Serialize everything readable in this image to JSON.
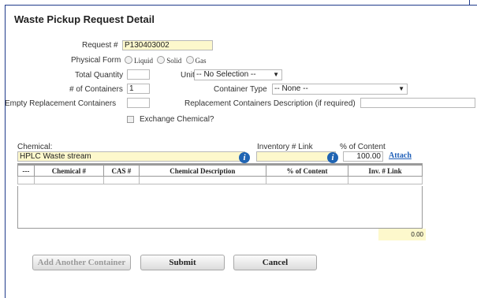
{
  "page_title": "Waste Pickup Request Detail",
  "request": {
    "label": "Request #",
    "value": "P130403002"
  },
  "physical_form": {
    "label": "Physical Form",
    "options": [
      "Liquid",
      "Solid",
      "Gas"
    ]
  },
  "total_quantity": {
    "label": "Total Quantity",
    "value": ""
  },
  "unit": {
    "label": "Unit",
    "selected": "-- No Selection --"
  },
  "num_containers": {
    "label": "# of Containers",
    "value": "1"
  },
  "container_type": {
    "label": "Container Type",
    "selected": "-- None --"
  },
  "empty_replacement": {
    "label": "Empty Replacement Containers",
    "value": ""
  },
  "replacement_desc": {
    "label": "Replacement Containers Description (if required)",
    "value": ""
  },
  "exchange_chemical": {
    "label": "Exchange Chemical?",
    "checked": false
  },
  "chemical": {
    "label": "Chemical:",
    "value": "HPLC Waste stream"
  },
  "inventory_link": {
    "label": "Inventory # Link",
    "value": ""
  },
  "percent_content": {
    "label": "% of Content",
    "value": "100.00"
  },
  "attach_link": "Attach",
  "table": {
    "columns": [
      "---",
      "Chemical #",
      "CAS #",
      "Chemical Description",
      "% of Content",
      "Inv. # Link"
    ],
    "total": "0.00"
  },
  "buttons": {
    "add_container": "Add Another Container",
    "submit": "Submit",
    "cancel": "Cancel"
  },
  "colors": {
    "accent": "#1f64b3",
    "required_bg": "#fdf8cc",
    "frame": "#1f3b8a"
  }
}
